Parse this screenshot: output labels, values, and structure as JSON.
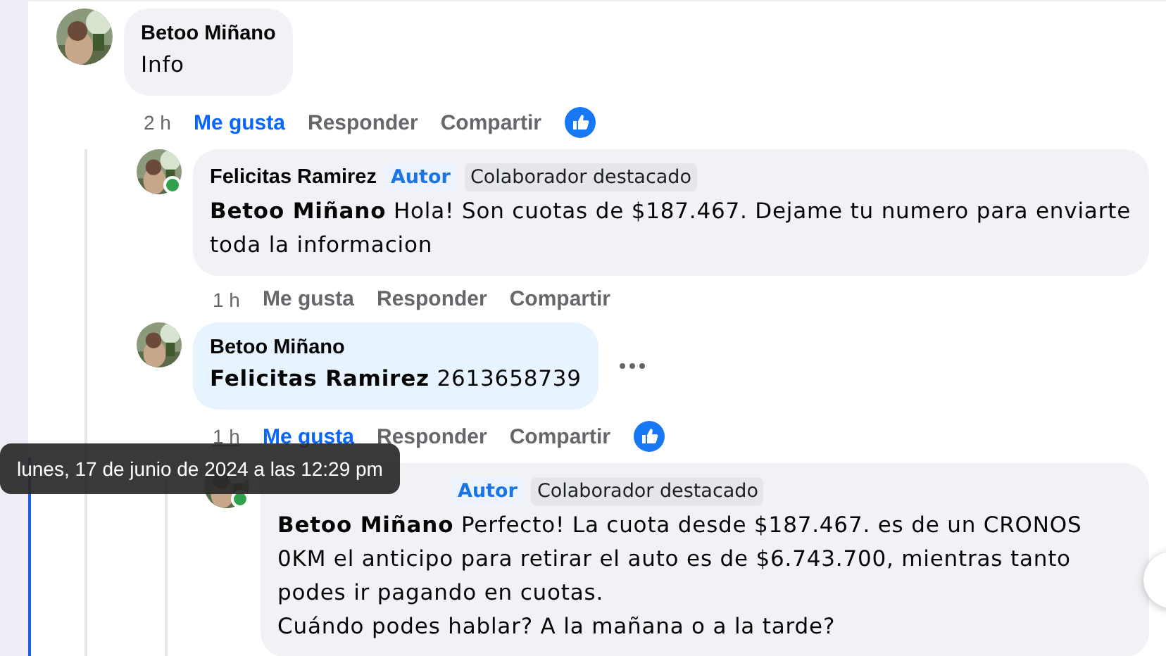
{
  "comments": [
    {
      "author": "Betoo Miñano",
      "online": false,
      "hovered": false,
      "text": "Info",
      "time": "2 h",
      "actions": [
        {
          "label": "Me gusta",
          "selected": true
        },
        {
          "label": "Responder",
          "selected": false
        },
        {
          "label": "Compartir",
          "selected": false
        }
      ],
      "reaction": true,
      "children": [
        {
          "author": "Felicitas Ramirez",
          "online": true,
          "hovered": false,
          "badges": [
            {
              "label": "Autor",
              "kind": "author"
            },
            {
              "label": "Colaborador destacado",
              "kind": "contributor"
            }
          ],
          "mention": "Betoo Miñano",
          "text": "Hola! Son cuotas de $187.467. Dejame tu numero para enviarte toda la informacion",
          "time": "1 h",
          "actions": [
            {
              "label": "Me gusta",
              "selected": false
            },
            {
              "label": "Responder",
              "selected": false
            },
            {
              "label": "Compartir",
              "selected": false
            }
          ],
          "reaction": false
        },
        {
          "author": "Betoo Miñano",
          "online": false,
          "hovered": true,
          "mention": "Felicitas Ramirez",
          "text": "2613658739",
          "time": "1 h",
          "actions": [
            {
              "label": "Me gusta",
              "selected": true
            },
            {
              "label": "Responder",
              "selected": false
            },
            {
              "label": "Compartir",
              "selected": false
            }
          ],
          "reaction": true,
          "children": [
            {
              "online": true,
              "hovered": false,
              "badges": [
                {
                  "label": "Autor",
                  "kind": "author"
                },
                {
                  "label": "Colaborador destacado",
                  "kind": "contributor"
                }
              ],
              "mention": "Betoo Miñano",
              "text": "Perfecto! La cuota desde $187.467. es de un CRONOS 0KM el anticipo para retirar el auto es de $6.743.700, mientras tanto podes ir pagando en cuotas.\nCuándo podes hablar? A la mañana o a la tarde?"
            }
          ]
        }
      ]
    }
  ],
  "tooltip": {
    "text": "lunes, 17 de junio de 2024 a las 12:29 pm"
  }
}
